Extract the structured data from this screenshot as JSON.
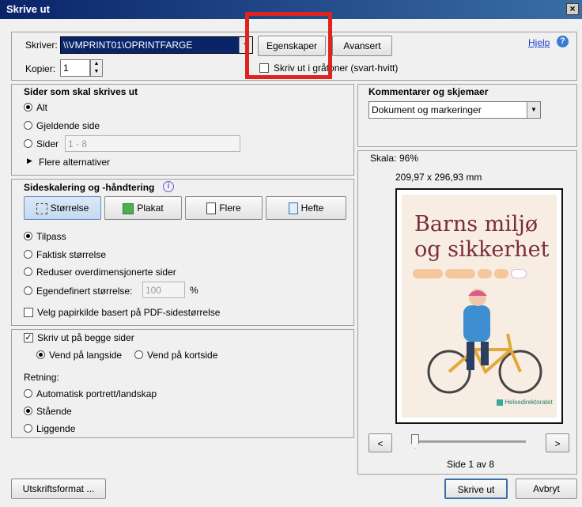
{
  "window": {
    "title": "Skrive ut",
    "close_glyph": "×"
  },
  "header": {
    "printer_label": "Skriver:",
    "printer_value": "\\\\VMPRINT01\\OPRINTFARGE",
    "properties_button": "Egenskaper",
    "advanced_button": "Avansert",
    "help_link": "Hjelp",
    "copies_label": "Kopier:",
    "copies_value": "1",
    "grayscale_label": "Skriv ut i gråtoner (svart-hvitt)"
  },
  "pages_group": {
    "title": "Sider som skal skrives ut",
    "options": [
      "Alt",
      "Gjeldende side",
      "Sider"
    ],
    "selected": "Alt",
    "range_placeholder": "1 - 8",
    "more_options": "Flere alternativer"
  },
  "scaling_group": {
    "title": "Sideskalering og -håndtering",
    "tabs": [
      "Størrelse",
      "Plakat",
      "Flere",
      "Hefte"
    ],
    "active_tab": "Størrelse",
    "options": [
      "Tilpass",
      "Faktisk størrelse",
      "Reduser overdimensjonerte sider",
      "Egendefinert størrelse:"
    ],
    "selected": "Tilpass",
    "custom_value": "100",
    "custom_unit": "%",
    "paper_source_label": "Velg papirkilde basert på PDF-sidestørrelse"
  },
  "duplex_group": {
    "both_sides_label": "Skriv ut på begge sider",
    "both_sides_checked": true,
    "flip_options": [
      "Vend på langside",
      "Vend på kortside"
    ],
    "flip_selected": "Vend på langside",
    "orientation_label": "Retning:",
    "orientation_options": [
      "Automatisk portrett/landskap",
      "Stående",
      "Liggende"
    ],
    "orientation_selected": "Stående"
  },
  "comments_group": {
    "title": "Kommentarer og skjemaer",
    "selected_value": "Dokument og markeringer"
  },
  "preview": {
    "scale_label": "Skala:",
    "scale_value": "96%",
    "size_text": "209,97 x 296,93 mm",
    "cover_title_line1": "Barns miljø",
    "cover_title_line2": "og sikkerhet",
    "cover_publisher": "Helsedirektoratet",
    "page_indicator": "Side 1 av 8",
    "prev_glyph": "<",
    "next_glyph": ">"
  },
  "footer": {
    "format_button": "Utskriftsformat ...",
    "print_button": "Skrive ut",
    "cancel_button": "Avbryt"
  },
  "colors": {
    "title_bar": "#0a246a",
    "highlight": "#e0231f",
    "accent_link": "#1a44c8",
    "cover_title": "#7b2d3b"
  }
}
